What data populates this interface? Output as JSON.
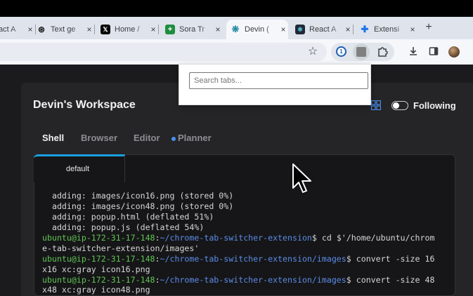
{
  "browser": {
    "tabs": [
      {
        "title": "React A",
        "fav_icon": "react-icon",
        "fav_color": "#1f2937",
        "fav_glyph": "⚛"
      },
      {
        "title": "Text ge",
        "fav_icon": "openai-icon",
        "fav_color": "#ffffff",
        "fav_glyph": "⊛"
      },
      {
        "title": "Home /",
        "fav_icon": "x-logo-icon",
        "fav_color": "#000000",
        "fav_glyph": "𝕏"
      },
      {
        "title": "Sora Tr",
        "fav_icon": "sheets-icon",
        "fav_color": "#1e8e3e",
        "fav_glyph": "+"
      },
      {
        "title": "Devin (",
        "fav_icon": "devin-icon",
        "fav_color": "#f5f7fb",
        "fav_glyph": "❋"
      },
      {
        "title": "React A",
        "fav_icon": "react-icon",
        "fav_color": "#1f2937",
        "fav_glyph": "⚛"
      },
      {
        "title": "Extensi",
        "fav_icon": "puzzle-icon",
        "fav_color": "#dfe3eb",
        "fav_glyph": "✚"
      }
    ],
    "new_tab_glyph": "+",
    "close_glyph": "×",
    "toolbar_icons": {
      "star": "☆",
      "onepassword": "1",
      "extensions": "⧉",
      "download": "⤓",
      "sidepanel": "▮"
    }
  },
  "popup": {
    "search_placeholder": "Search tabs..."
  },
  "workspace": {
    "title": "Devin's Workspace",
    "following_label": "Following",
    "tabs": {
      "shell": "Shell",
      "browser": "Browser",
      "editor": "Editor",
      "planner": "Planner"
    }
  },
  "terminal": {
    "tab_label": "default",
    "lines": {
      "l1": "  adding: images/icon16.png (stored 0%)",
      "l2": "  adding: images/icon48.png (stored 0%)",
      "l3": "  adding: popup.html (deflated 51%)",
      "l4": "  adding: popup.js (deflated 54%)",
      "l5_user": "ubuntu@ip-172-31-17-148",
      "l5_path": "~/chrome-tab-switcher-extension",
      "l5_cmd": "$ cd $'/home/ubuntu/chrom",
      "l6": "e-tab-switcher-extension/images'",
      "l7_user": "ubuntu@ip-172-31-17-148",
      "l7_path": "~/chrome-tab-switcher-extension/images",
      "l7_cmd": "$ convert -size 16",
      "l8": "x16 xc:gray icon16.png",
      "l9_user": "ubuntu@ip-172-31-17-148",
      "l9_path": "~/chrome-tab-switcher-extension/images",
      "l9_cmd": "$ convert -size 48",
      "l10": "x48 xc:gray icon48.png"
    }
  },
  "colors": {
    "prompt_user": "#61c454",
    "prompt_path": "#5b8be6",
    "active_tab_accent": "#1aa0e0",
    "planner_dot": "#4a8ff0"
  }
}
